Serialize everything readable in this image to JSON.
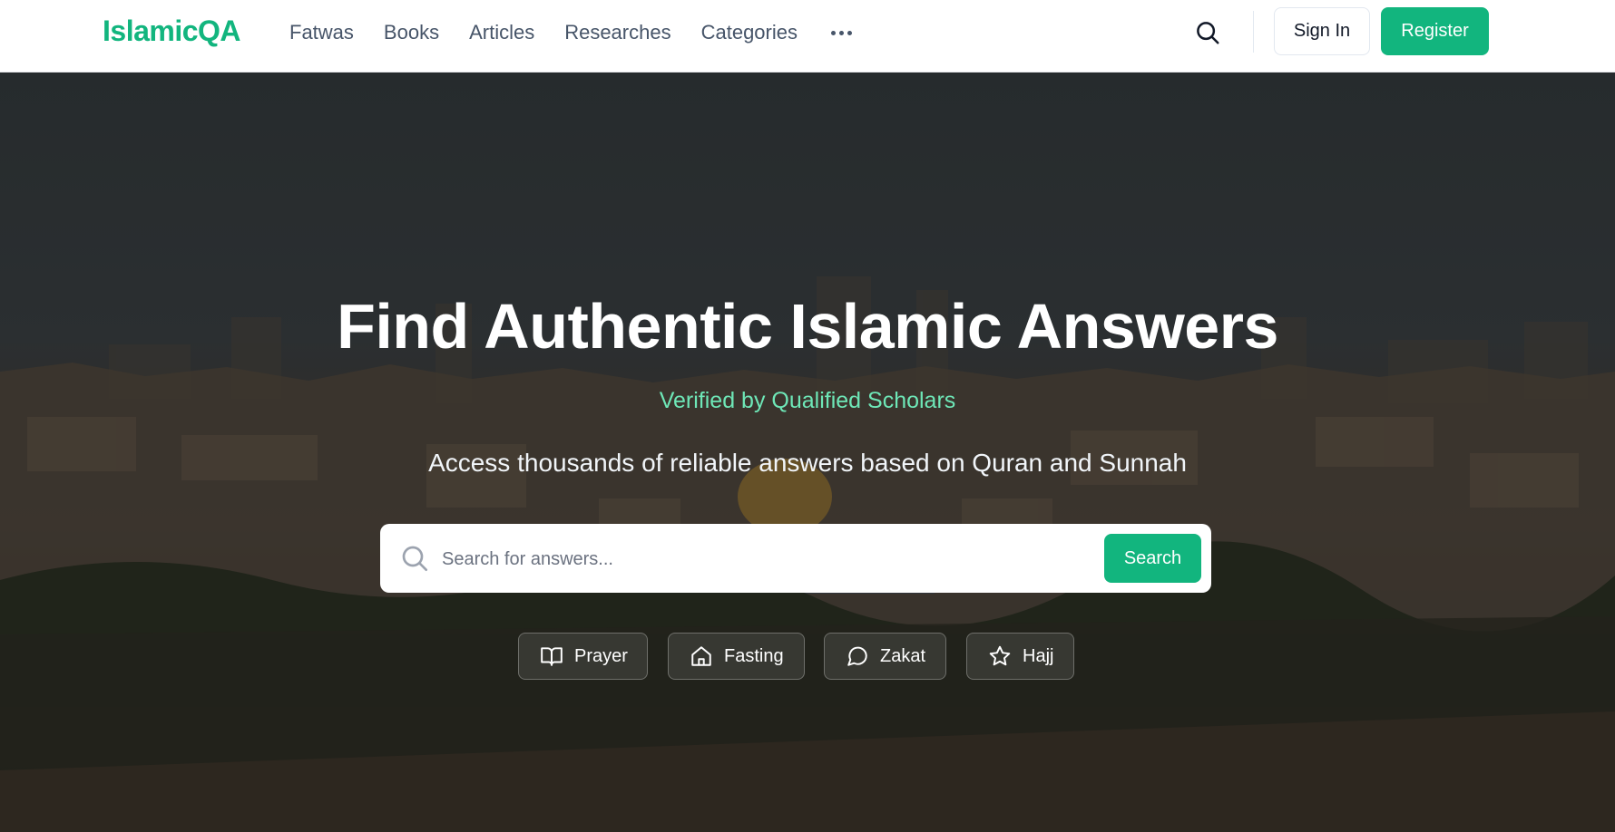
{
  "brand": {
    "name": "IslamicQA",
    "accent": "#12b57e"
  },
  "nav": {
    "items": [
      {
        "label": "Fatwas"
      },
      {
        "label": "Books"
      },
      {
        "label": "Articles"
      },
      {
        "label": "Researches"
      },
      {
        "label": "Categories"
      }
    ],
    "more_icon": "more-horizontal-icon"
  },
  "header": {
    "search_icon": "search-icon",
    "signin_label": "Sign In",
    "register_label": "Register"
  },
  "hero": {
    "title": "Find Authentic Islamic Answers",
    "subtitle": "Verified by Qualified Scholars",
    "description": "Access thousands of reliable answers based on Quran and Sunnah",
    "search": {
      "placeholder": "Search for answers...",
      "value": "",
      "button_label": "Search"
    },
    "categories": [
      {
        "label": "Prayer",
        "icon": "book-open-icon"
      },
      {
        "label": "Fasting",
        "icon": "home-icon"
      },
      {
        "label": "Zakat",
        "icon": "message-circle-icon"
      },
      {
        "label": "Hajj",
        "icon": "star-icon"
      }
    ]
  }
}
